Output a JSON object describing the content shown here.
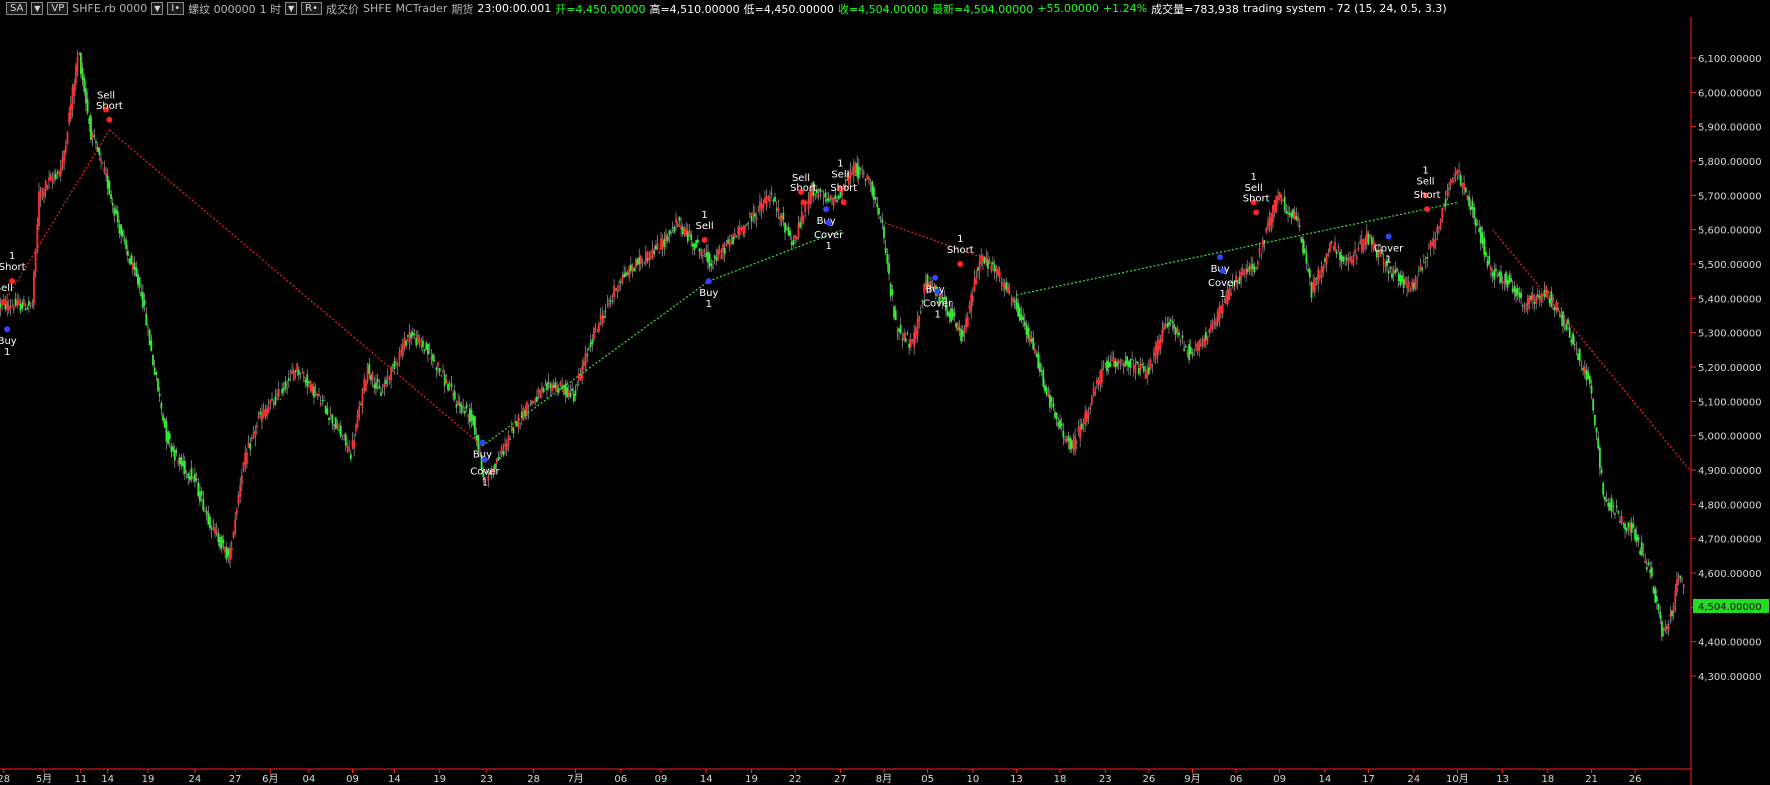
{
  "toolbar": {
    "sa_label": "SA",
    "dropdown_glyph": "▼",
    "vp_label": "VP",
    "symbol": "SHFE.rb 0000",
    "interval_btn": "I•",
    "name": "螺纹 000000",
    "timeframe": "1 时",
    "r_btn": "R•",
    "field": "成交价",
    "exchange": "SHFE",
    "source": "MCTrader",
    "category": "期货",
    "time": "23:00:00.001",
    "open": "开=4,450.00000",
    "high": "高=4,510.00000",
    "low": "低=4,450.00000",
    "close": "收=4,504.00000",
    "last": "最新=4,504.00000",
    "change": "+55.00000",
    "pct": "+1.24%",
    "volume": "成交量=783,938",
    "strategy": "trading system - 72 (15,  24,  0.5,  3.3)"
  },
  "colors": {
    "up": "#ff3030",
    "down": "#33ee33",
    "wick": "#bbbbbb",
    "short_line": "#ff2020",
    "long_line": "#33ee33",
    "buy_marker": "#3344ff",
    "sell_marker": "#ff2222",
    "axis": "#ff2020",
    "last_price_bg": "#22dd22"
  },
  "chart_data": {
    "type": "candlestick",
    "y_axis": {
      "min": 4300,
      "max": 6100,
      "step": 100,
      "format": "0,000.00000",
      "tick_labels": [
        "4,300.00000",
        "4,400.00000",
        "4,500.00000",
        "4,600.00000",
        "4,700.00000",
        "4,800.00000",
        "4,900.00000",
        "5,000.00000",
        "5,100.00000",
        "5,200.00000",
        "5,300.00000",
        "5,400.00000",
        "5,500.00000",
        "5,600.00000",
        "5,700.00000",
        "5,800.00000",
        "5,900.00000",
        "6,000.00000",
        "6,100.00000"
      ]
    },
    "x_axis": {
      "labels": [
        "28",
        "5月",
        "11",
        "14",
        "19",
        "24",
        "27",
        "6月",
        "04",
        "09",
        "14",
        "19",
        "23",
        "28",
        "7月",
        "06",
        "09",
        "14",
        "19",
        "22",
        "27",
        "8月",
        "05",
        "10",
        "13",
        "18",
        "23",
        "26",
        "9月",
        "06",
        "09",
        "14",
        "17",
        "24",
        "10月",
        "13",
        "18",
        "21",
        "26"
      ],
      "label_index": [
        4,
        52,
        96,
        128,
        176,
        232,
        280,
        322,
        368,
        420,
        470,
        524,
        580,
        636,
        686,
        740,
        788,
        842,
        896,
        948,
        1002,
        1054,
        1106,
        1160,
        1212,
        1264,
        1318,
        1370,
        1422,
        1474,
        1526,
        1580,
        1632,
        1686,
        1738,
        1792,
        1846,
        1898,
        1950
      ]
    },
    "last_price": 4504,
    "last_price_label": "4,504.00000",
    "price_path": [
      [
        0,
        5380
      ],
      [
        40,
        5380
      ],
      [
        48,
        5700
      ],
      [
        60,
        5740
      ],
      [
        75,
        5780
      ],
      [
        95,
        6120
      ],
      [
        110,
        5880
      ],
      [
        128,
        5750
      ],
      [
        150,
        5550
      ],
      [
        170,
        5420
      ],
      [
        185,
        5200
      ],
      [
        200,
        5000
      ],
      [
        215,
        4920
      ],
      [
        232,
        4880
      ],
      [
        250,
        4760
      ],
      [
        275,
        4640
      ],
      [
        290,
        4900
      ],
      [
        310,
        5050
      ],
      [
        335,
        5120
      ],
      [
        355,
        5200
      ],
      [
        370,
        5150
      ],
      [
        390,
        5080
      ],
      [
        420,
        4950
      ],
      [
        440,
        5200
      ],
      [
        455,
        5120
      ],
      [
        470,
        5200
      ],
      [
        490,
        5300
      ],
      [
        510,
        5250
      ],
      [
        524,
        5200
      ],
      [
        545,
        5100
      ],
      [
        565,
        5050
      ],
      [
        580,
        4870
      ],
      [
        600,
        4950
      ],
      [
        620,
        5050
      ],
      [
        636,
        5100
      ],
      [
        660,
        5150
      ],
      [
        686,
        5120
      ],
      [
        710,
        5300
      ],
      [
        740,
        5450
      ],
      [
        760,
        5500
      ],
      [
        788,
        5550
      ],
      [
        810,
        5620
      ],
      [
        830,
        5560
      ],
      [
        850,
        5500
      ],
      [
        870,
        5560
      ],
      [
        896,
        5630
      ],
      [
        920,
        5700
      ],
      [
        948,
        5560
      ],
      [
        970,
        5720
      ],
      [
        990,
        5680
      ],
      [
        1002,
        5700
      ],
      [
        1020,
        5780
      ],
      [
        1040,
        5740
      ],
      [
        1054,
        5600
      ],
      [
        1070,
        5320
      ],
      [
        1090,
        5260
      ],
      [
        1106,
        5450
      ],
      [
        1130,
        5380
      ],
      [
        1150,
        5280
      ],
      [
        1170,
        5520
      ],
      [
        1190,
        5480
      ],
      [
        1212,
        5380
      ],
      [
        1235,
        5250
      ],
      [
        1260,
        5050
      ],
      [
        1280,
        4960
      ],
      [
        1300,
        5080
      ],
      [
        1318,
        5200
      ],
      [
        1340,
        5220
      ],
      [
        1370,
        5180
      ],
      [
        1395,
        5340
      ],
      [
        1420,
        5240
      ],
      [
        1445,
        5300
      ],
      [
        1474,
        5450
      ],
      [
        1500,
        5500
      ],
      [
        1526,
        5700
      ],
      [
        1550,
        5620
      ],
      [
        1566,
        5420
      ],
      [
        1590,
        5560
      ],
      [
        1610,
        5500
      ],
      [
        1632,
        5580
      ],
      [
        1660,
        5480
      ],
      [
        1686,
        5430
      ],
      [
        1710,
        5560
      ],
      [
        1738,
        5780
      ],
      [
        1760,
        5640
      ],
      [
        1780,
        5480
      ],
      [
        1800,
        5450
      ],
      [
        1820,
        5380
      ],
      [
        1846,
        5420
      ],
      [
        1870,
        5320
      ],
      [
        1898,
        5150
      ],
      [
        1915,
        4820
      ],
      [
        1935,
        4760
      ],
      [
        1950,
        4720
      ],
      [
        1970,
        4600
      ],
      [
        1985,
        4420
      ],
      [
        1995,
        4480
      ],
      [
        2005,
        4600
      ],
      [
        2015,
        4520
      ]
    ],
    "trade_lines": [
      {
        "from": [
          0,
          5370
        ],
        "to": [
          130,
          5890
        ],
        "side": "short"
      },
      {
        "from": [
          130,
          5890
        ],
        "to": [
          575,
          4970
        ],
        "side": "short"
      },
      {
        "from": [
          575,
          4970
        ],
        "to": [
          845,
          5450
        ],
        "side": "long"
      },
      {
        "from": [
          845,
          5450
        ],
        "to": [
          1005,
          5600
        ],
        "side": "long"
      },
      {
        "from": [
          1055,
          5620
        ],
        "to": [
          1170,
          5520
        ],
        "side": "short"
      },
      {
        "from": [
          1212,
          5410
        ],
        "to": [
          1740,
          5680
        ],
        "side": "long"
      },
      {
        "from": [
          1780,
          5600
        ],
        "to": [
          2015,
          4900
        ],
        "side": "short"
      }
    ],
    "signals": [
      {
        "i": 4,
        "price": 5390,
        "label": "Sell",
        "side": "sell",
        "pos": "above"
      },
      {
        "i": 8,
        "price": 5310,
        "label": "Buy",
        "qty": "1",
        "side": "buy",
        "pos": "below"
      },
      {
        "i": 14,
        "price": 5450,
        "label": "Short",
        "qty": "1",
        "side": "sell",
        "pos": "above"
      },
      {
        "i": 126,
        "price": 5950,
        "label": "Sell",
        "side": "sell",
        "pos": "above"
      },
      {
        "i": 130,
        "price": 5920,
        "label": "Short",
        "side": "sell",
        "pos": "above"
      },
      {
        "i": 575,
        "price": 4980,
        "label": "Buy",
        "side": "buy",
        "pos": "below"
      },
      {
        "i": 578,
        "price": 4930,
        "label": "Cover",
        "qty": "1",
        "side": "buy",
        "pos": "below"
      },
      {
        "i": 840,
        "price": 5570,
        "label": "Sell",
        "qty": "1",
        "side": "sell",
        "pos": "above"
      },
      {
        "i": 845,
        "price": 5450,
        "label": "Buy",
        "qty": "1",
        "side": "buy",
        "pos": "below"
      },
      {
        "i": 955,
        "price": 5710,
        "label": "Sell",
        "side": "sell",
        "pos": "above"
      },
      {
        "i": 958,
        "price": 5680,
        "label": "Short",
        "side": "sell",
        "pos": "above"
      },
      {
        "i": 985,
        "price": 5660,
        "label": "Buy",
        "side": "buy",
        "pos": "below"
      },
      {
        "i": 988,
        "price": 5620,
        "label": "Cover",
        "qty": "1",
        "side": "buy",
        "pos": "below"
      },
      {
        "i": 1002,
        "price": 5720,
        "label": "Sell",
        "qty": "1",
        "side": "sell",
        "pos": "above"
      },
      {
        "i": 1006,
        "price": 5680,
        "label": "Short",
        "side": "sell",
        "pos": "above"
      },
      {
        "i": 1115,
        "price": 5460,
        "label": "Buy",
        "side": "buy",
        "pos": "below"
      },
      {
        "i": 1118,
        "price": 5420,
        "label": "Cover",
        "qty": "1",
        "side": "buy",
        "pos": "below"
      },
      {
        "i": 1145,
        "price": 5500,
        "label": "Short",
        "qty": "1",
        "side": "sell",
        "pos": "above"
      },
      {
        "i": 1455,
        "price": 5520,
        "label": "Buy",
        "side": "buy",
        "pos": "below"
      },
      {
        "i": 1458,
        "price": 5480,
        "label": "Cover",
        "qty": "1",
        "side": "buy",
        "pos": "below"
      },
      {
        "i": 1495,
        "price": 5680,
        "label": "Sell",
        "qty": "1",
        "side": "sell",
        "pos": "above"
      },
      {
        "i": 1498,
        "price": 5650,
        "label": "Short",
        "side": "sell",
        "pos": "above"
      },
      {
        "i": 1656,
        "price": 5580,
        "label": "Cover",
        "qty": "1",
        "side": "buy",
        "pos": "below"
      },
      {
        "i": 1700,
        "price": 5700,
        "label": "Sell",
        "qty": "1",
        "side": "sell",
        "pos": "above"
      },
      {
        "i": 1702,
        "price": 5660,
        "label": "Short",
        "side": "sell",
        "pos": "above"
      }
    ]
  }
}
